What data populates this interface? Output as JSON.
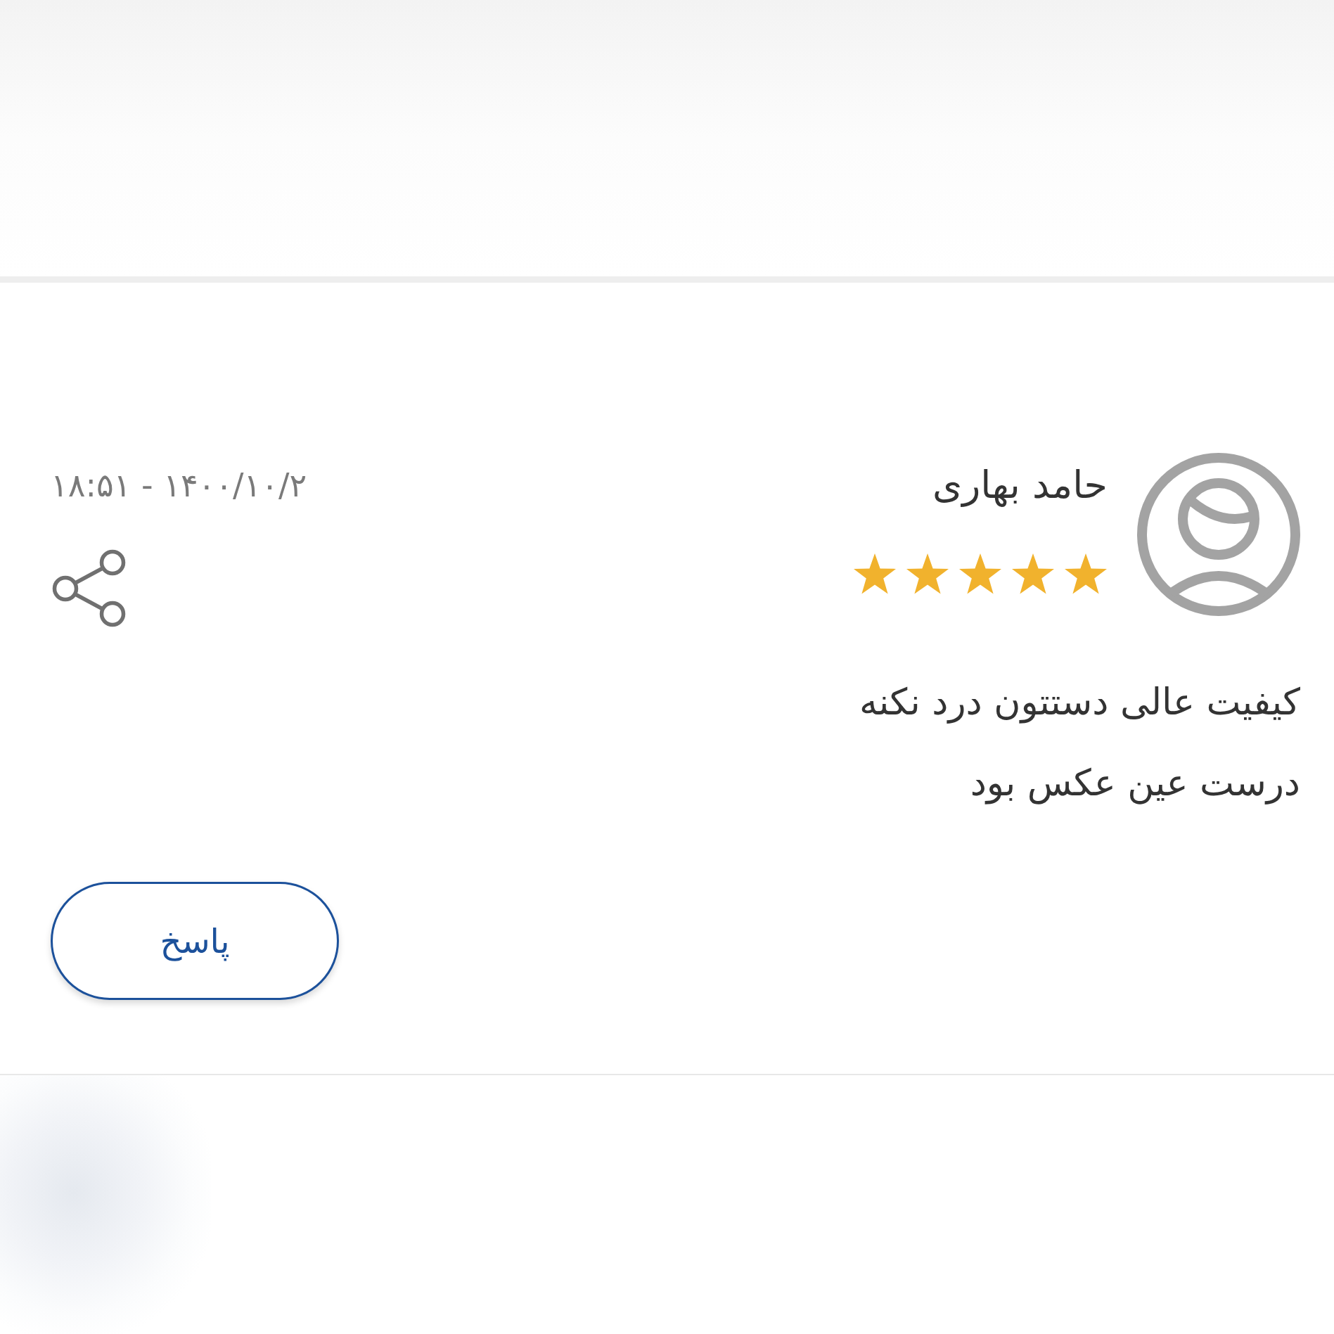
{
  "review": {
    "author": "حامد بهاری",
    "stars": 5,
    "date": "۱۴۰۰/۱۰/۲ - ۱۸:۵۱",
    "comment_lines": [
      "کیفیت عالی دستتون درد نکنه",
      "درست عین عکس بود"
    ],
    "reply_button": "پاسخ"
  }
}
